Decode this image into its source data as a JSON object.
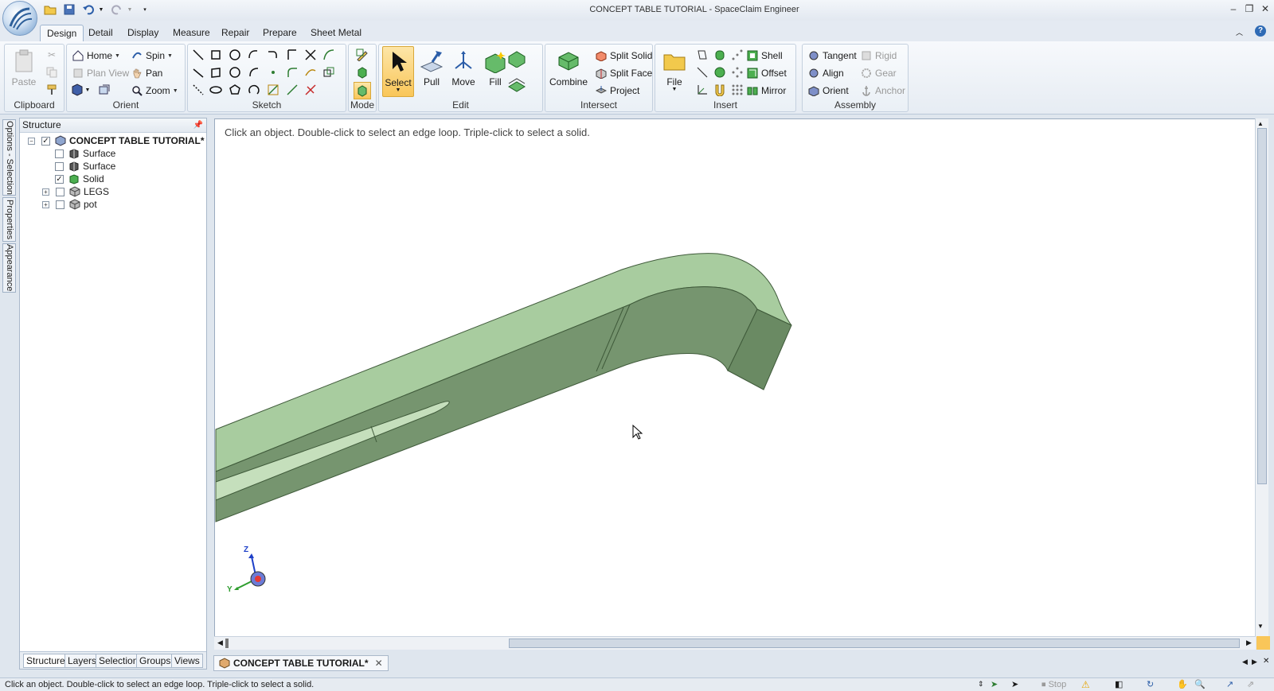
{
  "window": {
    "title": "CONCEPT TABLE TUTORIAL - SpaceClaim Engineer",
    "minimize": "–",
    "restore": "❐",
    "close": "✕"
  },
  "tabs": [
    "Design",
    "Detail",
    "Display",
    "Measure",
    "Repair",
    "Prepare",
    "Sheet Metal"
  ],
  "active_tab": "Design",
  "ribbon": {
    "clipboard": {
      "label": "Clipboard",
      "paste": "Paste"
    },
    "orient": {
      "label": "Orient",
      "home": "Home",
      "spin": "Spin",
      "plan_view": "Plan View",
      "pan": "Pan",
      "zoom": "Zoom"
    },
    "sketch": {
      "label": "Sketch"
    },
    "mode": {
      "label": "Mode"
    },
    "edit": {
      "label": "Edit",
      "select": "Select",
      "pull": "Pull",
      "move": "Move",
      "fill": "Fill"
    },
    "intersect": {
      "label": "Intersect",
      "combine": "Combine",
      "split_solid": "Split Solid",
      "split_face": "Split Face",
      "project": "Project"
    },
    "insert": {
      "label": "Insert",
      "file": "File",
      "shell": "Shell",
      "offset": "Offset",
      "mirror": "Mirror"
    },
    "assembly": {
      "label": "Assembly",
      "tangent": "Tangent",
      "align": "Align",
      "orient": "Orient",
      "rigid": "Rigid",
      "gear": "Gear",
      "anchor": "Anchor"
    }
  },
  "side_tabs": [
    "Options - Selection",
    "Properties",
    "Appearance"
  ],
  "structure": {
    "title": "Structure",
    "root": "CONCEPT TABLE TUTORIAL*",
    "items": [
      {
        "label": "Surface",
        "checked": false
      },
      {
        "label": "Surface",
        "checked": false
      },
      {
        "label": "Solid",
        "checked": true
      },
      {
        "label": "LEGS",
        "checked": false
      },
      {
        "label": "pot",
        "checked": false
      }
    ],
    "tabs": [
      "Structure",
      "Layers",
      "Selection",
      "Groups",
      "Views"
    ]
  },
  "viewport": {
    "hint": "Click an object. Double-click to select an edge loop. Triple-click to select a solid.",
    "axis_z": "Z",
    "axis_y": "Y"
  },
  "document_tab": "CONCEPT TABLE TUTORIAL*",
  "status": {
    "text": "Click an object. Double-click to select an edge loop. Triple-click to select a solid.",
    "stop": "Stop"
  },
  "colors": {
    "face_top": "#a8cc9f",
    "face_side": "#76956f",
    "selected": "#f9c659"
  }
}
